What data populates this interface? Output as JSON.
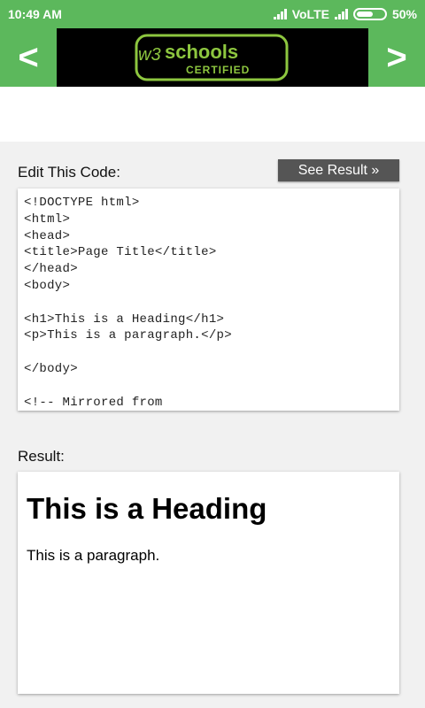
{
  "status_bar": {
    "time": "10:49 AM",
    "network": "VoLTE",
    "battery": "50%",
    "battery_level": 50
  },
  "header": {
    "prev_label": "<",
    "next_label": ">",
    "banner": {
      "brand_prefix": "w3",
      "brand": "schools",
      "sub": "CERTIFIED"
    }
  },
  "editor": {
    "label": "Edit This Code:",
    "see_result_label": "See Result »",
    "code": "<!DOCTYPE html>\n<html>\n<head>\n<title>Page Title</title>\n</head>\n<body>\n\n<h1>This is a Heading</h1>\n<p>This is a paragraph.</p>\n\n</body>\n\n<!-- Mirrored from"
  },
  "result": {
    "label": "Result:",
    "heading": "This is a Heading",
    "paragraph": "This is a paragraph."
  },
  "colors": {
    "brand_green": "#5cb85c",
    "button_gray": "#555555",
    "logo_green": "#8dc63f"
  }
}
